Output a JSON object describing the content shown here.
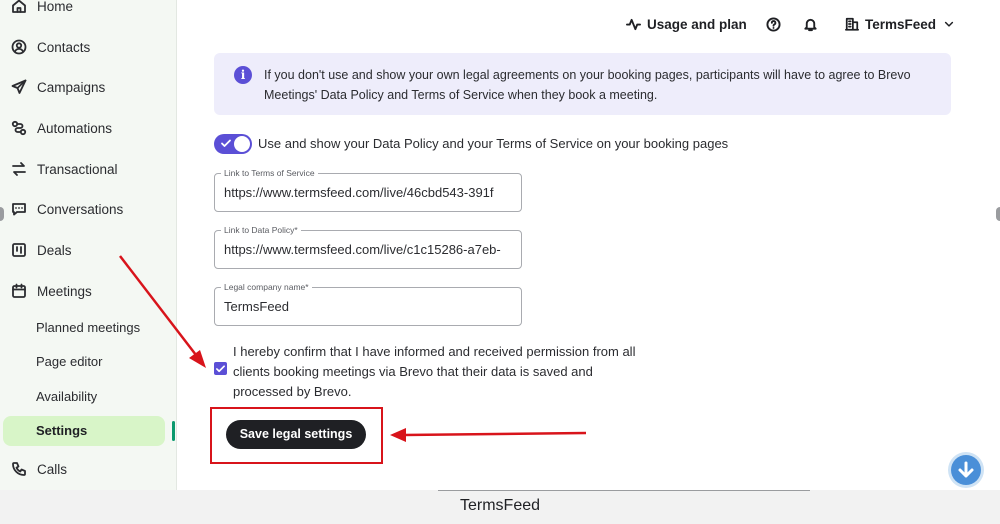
{
  "sidebar": {
    "items": [
      {
        "label": "Home",
        "icon": "home-icon"
      },
      {
        "label": "Contacts",
        "icon": "contacts-icon"
      },
      {
        "label": "Campaigns",
        "icon": "send-icon"
      },
      {
        "label": "Automations",
        "icon": "automations-icon"
      },
      {
        "label": "Transactional",
        "icon": "arrows-icon"
      },
      {
        "label": "Conversations",
        "icon": "chat-icon"
      },
      {
        "label": "Deals",
        "icon": "board-icon"
      },
      {
        "label": "Meetings",
        "icon": "calendar-icon"
      }
    ],
    "meetings_sub": [
      "Planned meetings",
      "Page editor",
      "Availability",
      "Settings"
    ],
    "calls": {
      "label": "Calls",
      "icon": "phone-icon"
    },
    "active_color": "#d8f5c8"
  },
  "header": {
    "usage": "Usage and plan",
    "account": "TermsFeed"
  },
  "info": {
    "text": "If you don't use and show your own legal agreements on your booking pages, participants will have to agree to Brevo Meetings' Data Policy and Terms of Service when they book a meeting."
  },
  "toggle": {
    "label": "Use and show your Data Policy and your Terms of Service on your booking pages",
    "on": true
  },
  "fields": {
    "terms": {
      "label": "Link to Terms of Service",
      "value": "https://www.termsfeed.com/live/46cbd543-391f"
    },
    "data_policy": {
      "label": "Link to Data Policy*",
      "value": "https://www.termsfeed.com/live/c1c15286-a7eb-"
    },
    "company": {
      "label": "Legal company name*",
      "value": "TermsFeed"
    }
  },
  "confirm": {
    "text": "I hereby confirm that I have informed and received permission from all clients booking meetings via Brevo that their data is saved and processed by Brevo.",
    "checked": true
  },
  "save_button": "Save legal settings",
  "footer": {
    "brand": "TermsFeed"
  },
  "colors": {
    "accent": "#5b4fd6",
    "annotation": "#d8141b",
    "button": "#1f2024"
  }
}
